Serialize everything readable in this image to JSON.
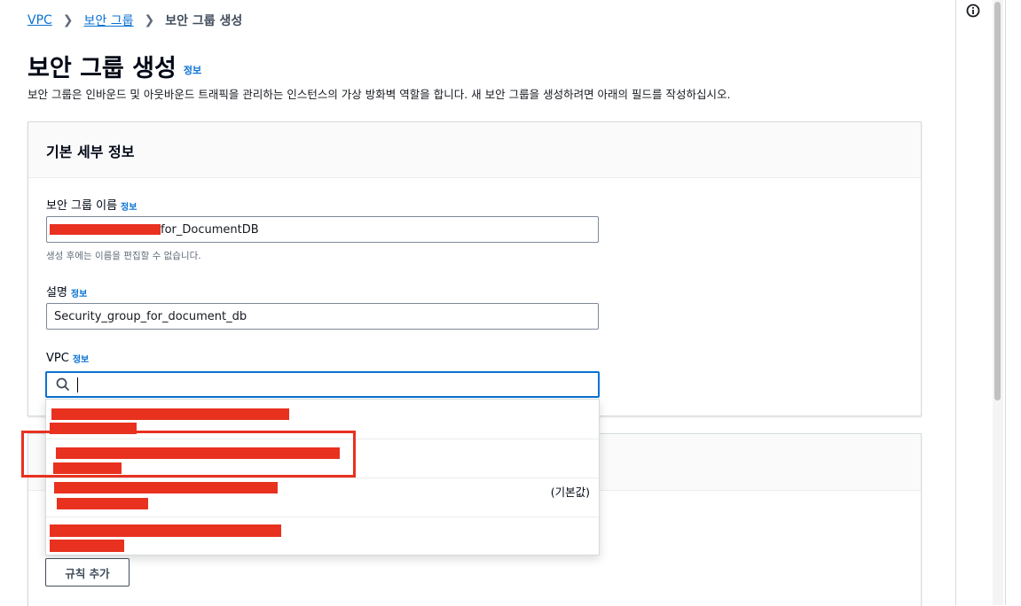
{
  "breadcrumb": {
    "item1": "VPC",
    "item2": "보안 그룹",
    "current": "보안 그룹 생성"
  },
  "page": {
    "title": "보안 그룹 생성",
    "title_info": "정보",
    "description": "보안 그룹은 인바운드 및 아웃바운드 트래픽을 관리하는 인스턴스의 가상 방화벽 역할을 합니다. 새 보안 그룹을 생성하려면 아래의 필드를 작성하십시오."
  },
  "basic_details": {
    "heading": "기본 세부 정보",
    "name_label": "보안 그룹 이름",
    "name_info": "정보",
    "name_value_suffix": "for_DocumentDB",
    "name_hint": "생성 후에는 이름을 편집할 수 없습니다.",
    "desc_label": "설명",
    "desc_info": "정보",
    "desc_value": "Security_group_for_document_db",
    "vpc_label": "VPC",
    "vpc_info": "정보",
    "vpc_search_value": ""
  },
  "vpc_dropdown": {
    "default_tag": "(기본값)"
  },
  "inbound": {
    "add_rule_label": "규칙 추가"
  },
  "colors": {
    "accent": "#0972d3",
    "redaction": "#e8311f"
  },
  "icons": {
    "search": "search-icon",
    "info": "info-icon",
    "chevron": "chevron-right-icon"
  }
}
